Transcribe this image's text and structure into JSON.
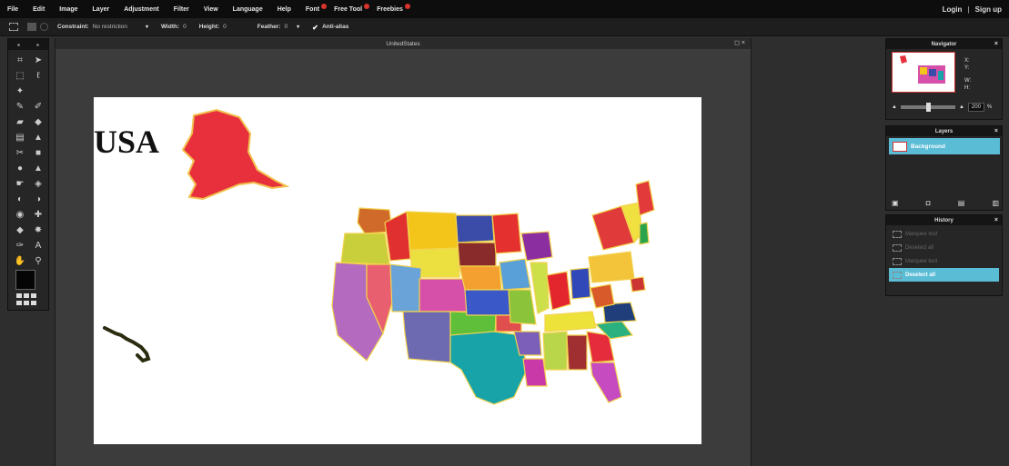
{
  "menu": {
    "items": [
      {
        "label": "File",
        "badge": false
      },
      {
        "label": "Edit",
        "badge": false
      },
      {
        "label": "Image",
        "badge": false
      },
      {
        "label": "Layer",
        "badge": false
      },
      {
        "label": "Adjustment",
        "badge": false
      },
      {
        "label": "Filter",
        "badge": false
      },
      {
        "label": "View",
        "badge": false
      },
      {
        "label": "Language",
        "badge": false
      },
      {
        "label": "Help",
        "badge": false
      },
      {
        "label": "Font",
        "badge": true
      },
      {
        "label": "Free Tool",
        "badge": true
      },
      {
        "label": "Freebies",
        "badge": true
      }
    ],
    "login": "Login",
    "divider": "|",
    "signup": "Sign up"
  },
  "options": {
    "constraint_label": "Constraint:",
    "constraint_value": "No restriction",
    "width_label": "Width:",
    "width_value": "0",
    "height_label": "Height:",
    "height_value": "0",
    "feather_label": "Feather:",
    "feather_value": "0",
    "antialias_label": "Anti-alias",
    "antialias_checked": true
  },
  "toolbox": {
    "prev": "◂",
    "next": "▸",
    "tools": [
      "crop-icon",
      "move-icon",
      "marquee-icon",
      "lasso-icon",
      "magic-wand-icon",
      "blank",
      "pencil-icon",
      "brush-icon",
      "eraser-icon",
      "bucket-icon",
      "gradient-icon",
      "stamp-icon",
      "color-replace-icon",
      "drawing-icon",
      "blur-icon",
      "sharpen-icon",
      "smudge-icon",
      "sponge-icon",
      "dodge-icon",
      "burn-icon",
      "red-eye-icon",
      "spot-heal-icon",
      "bloat-icon",
      "pinch-icon",
      "color-picker-icon",
      "type-icon",
      "hand-icon",
      "zoom-icon"
    ],
    "primary_color": "#050505"
  },
  "document": {
    "title": "UnitedStates",
    "controls": "◻ ×",
    "canvas_text": "USA"
  },
  "navigator": {
    "title": "Navigator",
    "close": "×",
    "x_label": "X:",
    "y_label": "Y:",
    "w_label": "W:",
    "h_label": "H:",
    "zoom": "200",
    "zoom_unit": "%"
  },
  "layers": {
    "title": "Layers",
    "close": "×",
    "items": [
      {
        "name": "Background"
      }
    ]
  },
  "history": {
    "title": "History",
    "close": "×",
    "items": [
      {
        "label": "Marquee tool",
        "active": false
      },
      {
        "label": "Deselect all",
        "active": false
      },
      {
        "label": "Marquee tool",
        "active": false
      },
      {
        "label": "Deselect all",
        "active": true
      }
    ]
  },
  "colors": {
    "accent": "#5bbcd6",
    "badge": "#d9332b",
    "canvas_bg": "#ffffff",
    "app_bg": "#2e2e2e"
  }
}
